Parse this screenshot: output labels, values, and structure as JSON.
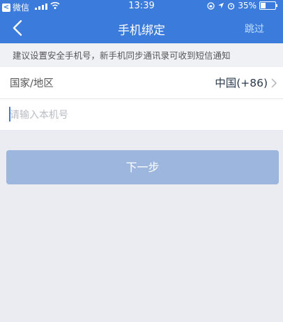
{
  "status_bar": {
    "back_app": "微信",
    "time": "13:39",
    "battery": "35%",
    "battery_level": 0.35
  },
  "header": {
    "title": "手机绑定",
    "skip": "跳过"
  },
  "notice": "建议设置安全手机号，新手机同步通讯录可收到短信通知",
  "country_row": {
    "label": "国家/地区",
    "value": "中国(+86)"
  },
  "phone_input": {
    "placeholder": "请输入本机号",
    "value": ""
  },
  "next_button": "下一步",
  "colors": {
    "header": "#3a7bdc",
    "button_disabled": "#9cb6dd",
    "skip_text": "#bfe0ff"
  }
}
